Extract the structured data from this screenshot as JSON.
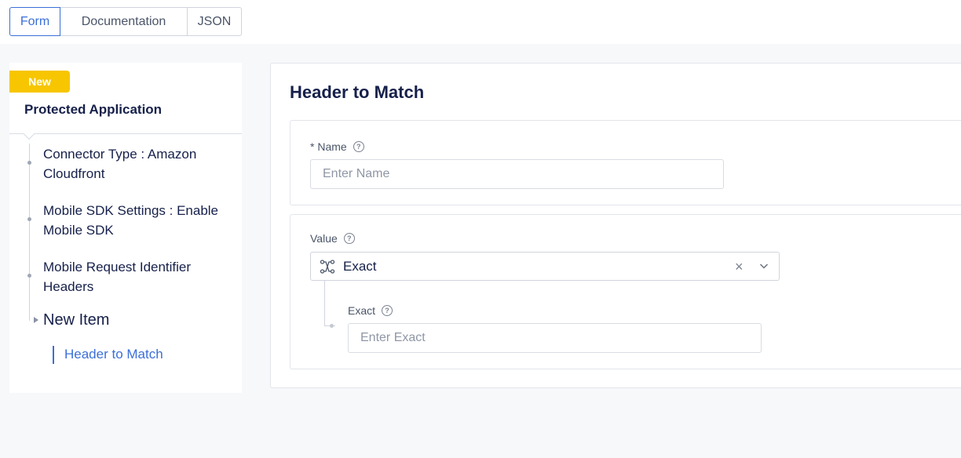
{
  "tabs": [
    {
      "label": "Form",
      "active": true
    },
    {
      "label": "Documentation",
      "active": false
    },
    {
      "label": "JSON",
      "active": false
    }
  ],
  "sidebar": {
    "badge": "New",
    "title": "Protected Application",
    "items": [
      {
        "label": "Connector Type : Amazon Cloudfront"
      },
      {
        "label": "Mobile SDK Settings : Enable Mobile SDK"
      },
      {
        "label": "Mobile Request Identifier Headers"
      }
    ],
    "new_item": "New Item",
    "sub_item": "Header to Match"
  },
  "main": {
    "title": "Header to Match",
    "name_field": {
      "label": "* Name",
      "help": "?",
      "placeholder": "Enter Name",
      "value": ""
    },
    "value_field": {
      "label": "Value",
      "help": "?",
      "selected": "Exact",
      "clear": "×",
      "exact": {
        "label": "Exact",
        "help": "?",
        "placeholder": "Enter Exact",
        "value": ""
      }
    }
  },
  "colors": {
    "accent": "#3b6fd8",
    "badge": "#f7c600",
    "heading": "#16204a"
  },
  "icons": {
    "select_type": "branch-icon",
    "clear": "close-icon",
    "dropdown": "chevron-down-icon",
    "help": "help-circle-icon"
  }
}
